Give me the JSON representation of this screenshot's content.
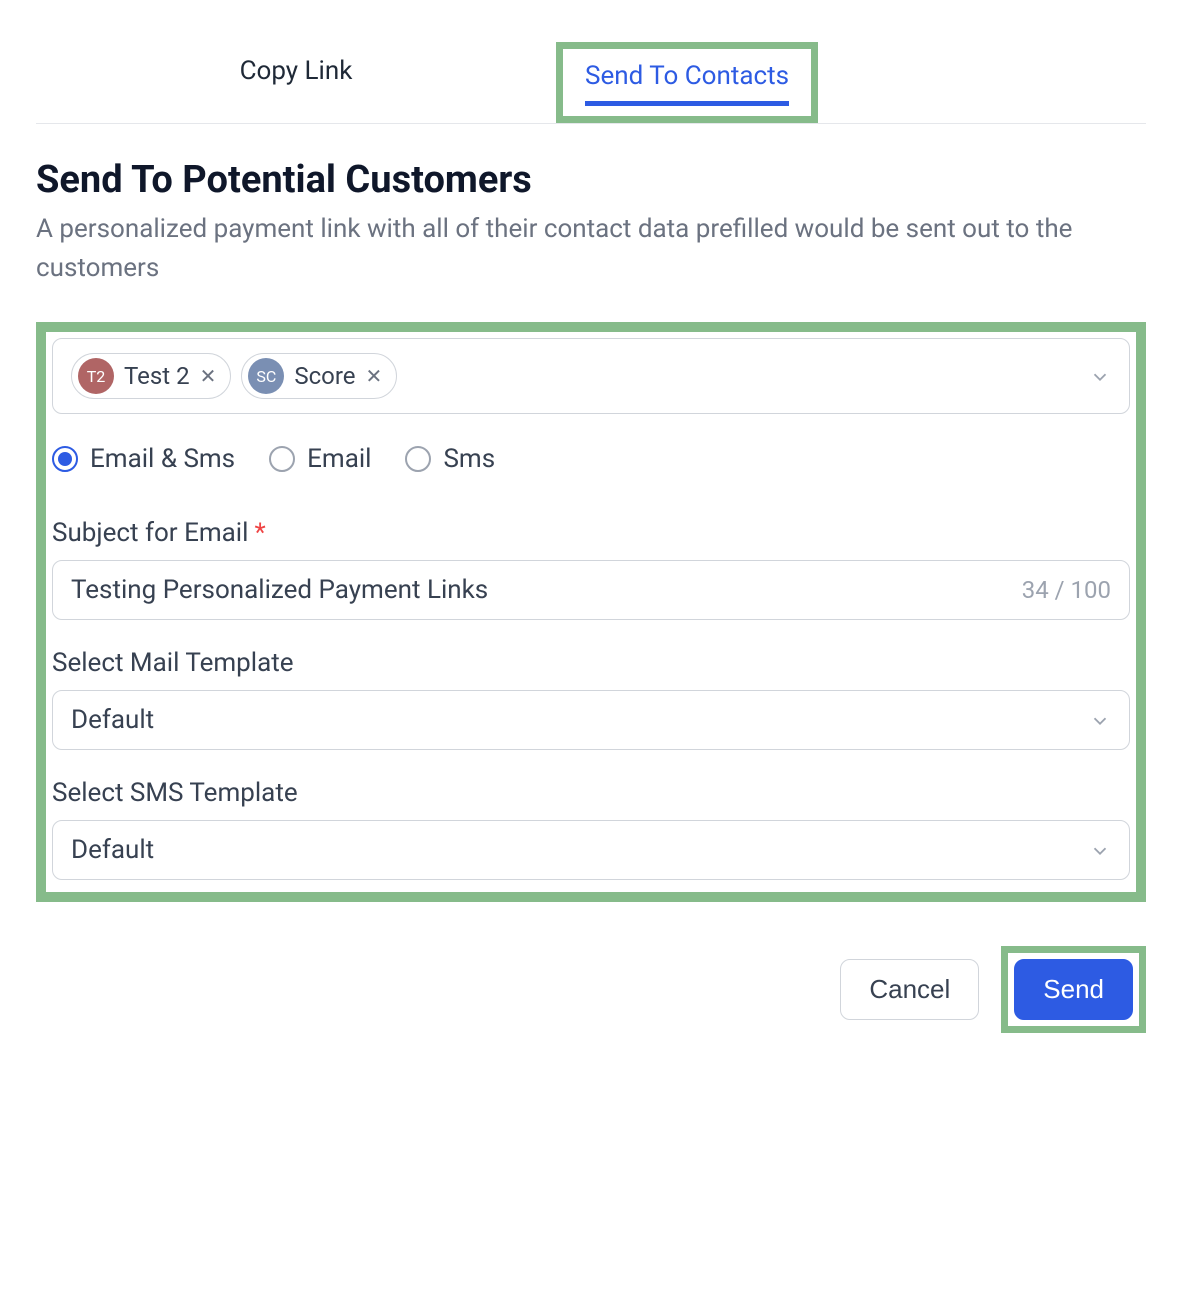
{
  "tabs": {
    "copy": "Copy Link",
    "send": "Send To Contacts"
  },
  "heading": "Send To Potential Customers",
  "subheading": "A personalized payment link with all of their contact data prefilled would be sent out to the customers",
  "contacts": {
    "chips": [
      {
        "initials": "T2",
        "label": "Test 2"
      },
      {
        "initials": "SC",
        "label": "Score"
      }
    ]
  },
  "channels": {
    "options": [
      {
        "label": "Email & Sms",
        "checked": true
      },
      {
        "label": "Email",
        "checked": false
      },
      {
        "label": "Sms",
        "checked": false
      }
    ]
  },
  "subject": {
    "label": "Subject for Email",
    "value": "Testing Personalized Payment Links",
    "counter": "34 / 100"
  },
  "mail_template": {
    "label": "Select Mail Template",
    "value": "Default"
  },
  "sms_template": {
    "label": "Select SMS Template",
    "value": "Default"
  },
  "footer": {
    "cancel": "Cancel",
    "send": "Send"
  }
}
